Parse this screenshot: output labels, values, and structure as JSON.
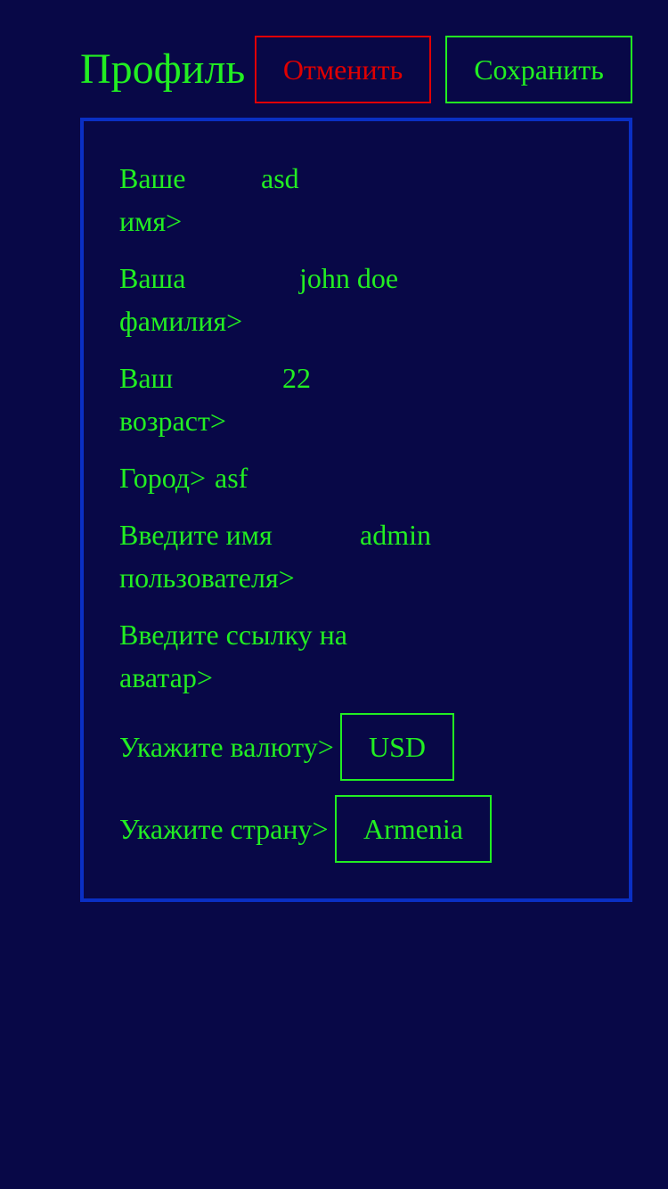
{
  "header": {
    "title": "Профиль",
    "cancel_label": "Отменить",
    "save_label": "Сохранить"
  },
  "form": {
    "first_name": {
      "label": "Ваше\nимя>",
      "value": "asd"
    },
    "last_name": {
      "label": "Ваша\nфамилия>",
      "value": "john doe"
    },
    "age": {
      "label": "Ваш\nвозраст>",
      "value": "22"
    },
    "city": {
      "label": "Город>",
      "value": "asf"
    },
    "username": {
      "label": "Введите имя\nпользователя>",
      "value": "admin"
    },
    "avatar": {
      "label": "Введите ссылку на\nаватар>",
      "value": ""
    },
    "currency": {
      "label": "Укажите валюту>",
      "value": "USD"
    },
    "country": {
      "label": "Укажите страну>",
      "value": "Armenia"
    }
  },
  "colors": {
    "background": "#080847",
    "text": "#22ee22",
    "cancel": "#e00000",
    "panel_border": "#0a2fc4"
  }
}
